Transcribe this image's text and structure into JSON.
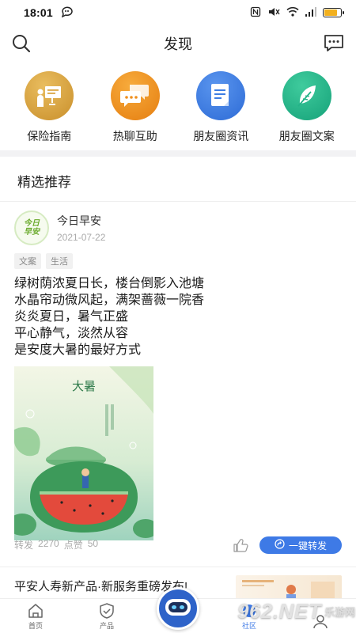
{
  "status_bar": {
    "time": "18:01",
    "battery_level": 0.8
  },
  "header": {
    "title": "发现",
    "icons": [
      "search-icon",
      "message-icon"
    ]
  },
  "quick_entries": [
    {
      "label": "保险指南",
      "icon": "presentation-icon",
      "color": "#d9a441"
    },
    {
      "label": "热聊互助",
      "icon": "chat-icon",
      "color": "#f08f1c"
    },
    {
      "label": "朋友圈资讯",
      "icon": "document-icon",
      "color": "#3d7de3"
    },
    {
      "label": "朋友圈文案",
      "icon": "feather-icon",
      "color": "#24b388"
    }
  ],
  "featured": {
    "title": "精选推荐",
    "post": {
      "avatar_text": [
        "今日",
        "早安"
      ],
      "author": "今日早安",
      "date": "2021-07-22",
      "tags": [
        "文案",
        "生活"
      ],
      "lines": [
        "绿树荫浓夏日长，楼台倒影入池塘",
        "水晶帘动微风起，满架蔷薇一院香",
        "炎炎夏日，暑气正盛",
        "平心静气，淡然从容",
        "是安度大暑的最好方式"
      ],
      "image_title": "大暑",
      "stats": {
        "shares_label": "转发",
        "shares": "2270",
        "likes_label": "点赞",
        "likes": "50"
      },
      "share_button": "一键转发"
    }
  },
  "news": {
    "headline": "平安人寿新产品·新服务重磅发布!"
  },
  "tabbar": {
    "items": [
      {
        "label": "首页",
        "icon": "home-icon"
      },
      {
        "label": "产品",
        "icon": "shield-icon"
      },
      {
        "label": "",
        "icon": "robot-icon"
      },
      {
        "label": "社区",
        "icon": "community-icon"
      },
      {
        "label": "",
        "icon": "user-icon"
      }
    ],
    "active": 3
  },
  "watermark": {
    "text": "962.NET",
    "sub": "乐游网"
  },
  "colors": {
    "accent": "#3e7ae6",
    "tag_bg": "#f1f1f1"
  }
}
